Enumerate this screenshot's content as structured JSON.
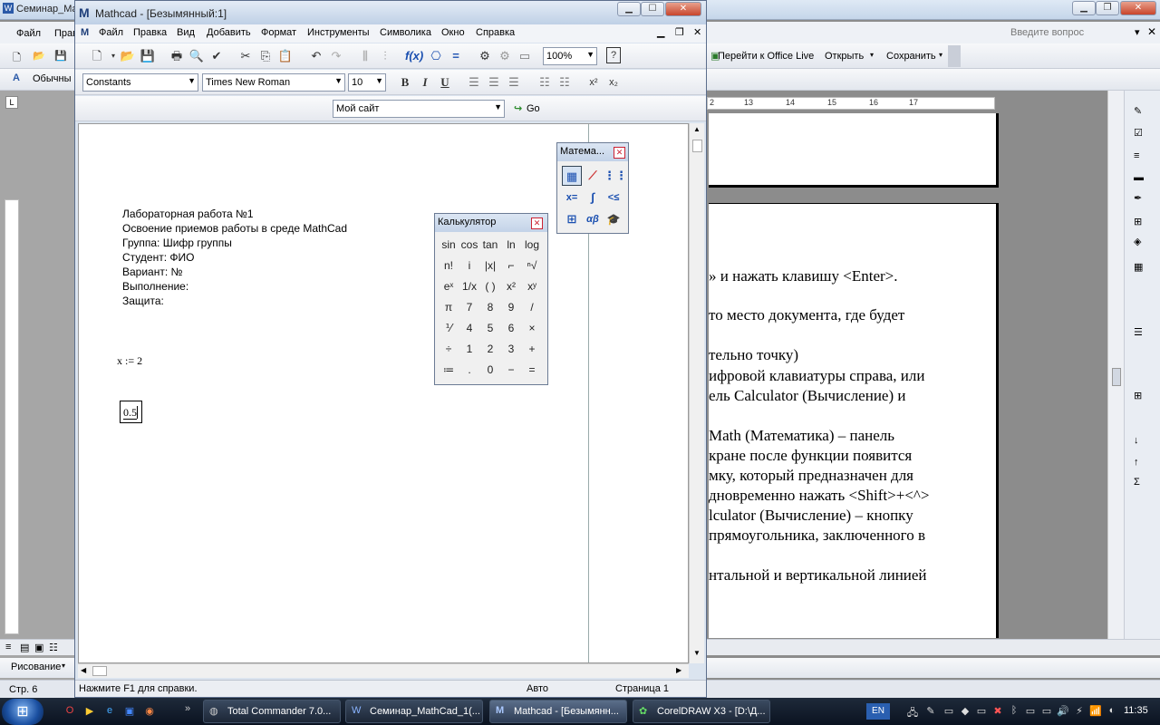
{
  "word": {
    "title": "Семинар_Ма",
    "menu": [
      "Файл",
      "Прав"
    ],
    "style_label": "Обычны",
    "office_live": "Перейти к Office Live",
    "open": "Открыть",
    "save": "Сохранить",
    "question_placeholder": "Введите вопрос",
    "ruler_ticks": [
      "2",
      "13",
      "14",
      "15",
      "16",
      "17"
    ],
    "page_lines": [
      "» и нажать клавишу <Enter>.",
      "то место документа, где будет",
      "тельно точку)",
      "ифровой клавиатуры справа, или",
      "ель Calculator (Вычисление) и",
      "Math (Математика) – панель",
      "кране после функции появится",
      "мку, который предназначен для",
      "дновременно нажать <Shift>+<^>",
      "lculator (Вычисление) – кнопку",
      "прямоугольника, заключенного в",
      "нтальной и вертикальной линией"
    ],
    "draw_label": "Рисование",
    "status_page": "Стр. 6",
    "status_page_num": "6"
  },
  "mathcad": {
    "title": "Mathcad - [Безымянный:1]",
    "menu": [
      "Файл",
      "Правка",
      "Вид",
      "Добавить",
      "Формат",
      "Инструменты",
      "Символика",
      "Окно",
      "Справка"
    ],
    "zoom": "100%",
    "style_combo": "Constants",
    "font_combo": "Times New Roman",
    "size_combo": "10",
    "bold": "B",
    "italic": "I",
    "underline": "U",
    "site_combo": "Мой сайт",
    "go": "Go",
    "doc_lines": [
      "Лабораторная работа №1",
      "Освоение приемов работы в среде MathCad",
      "Группа: Шифр группы",
      "Студент: ФИО",
      "Вариант: №",
      "Выполнение:",
      "Защита:"
    ],
    "expr": "x := 2",
    "input_value": "0.5",
    "status_help": "Нажмите F1 для справки.",
    "status_mode": "Авто",
    "status_page": "Страница 1"
  },
  "math_palette": {
    "title": "Матема...",
    "icons": [
      "calculator-icon",
      "graph-icon",
      "matrix-icon",
      "evaluation-icon",
      "calculus-icon",
      "boolean-icon",
      "programming-icon",
      "greek-icon",
      "symbolic-icon"
    ],
    "glyphs": [
      "▦",
      "⟋",
      "⋮⋮",
      "x=",
      "∫",
      "<≤",
      "⊞",
      "αβ",
      "🎓"
    ]
  },
  "calculator": {
    "title": "Калькулятор",
    "keys": [
      [
        "sin",
        "cos",
        "tan",
        "ln",
        "log"
      ],
      [
        "n!",
        "i",
        "|x|",
        "⌐",
        "ⁿ√"
      ],
      [
        "eˣ",
        "1/x",
        "( )",
        "x²",
        "xʸ"
      ],
      [
        "π",
        "7",
        "8",
        "9",
        "/"
      ],
      [
        "⅟",
        "4",
        "5",
        "6",
        "×"
      ],
      [
        "÷",
        "1",
        "2",
        "3",
        "+"
      ],
      [
        "≔",
        ".",
        "0",
        "−",
        "="
      ]
    ]
  },
  "taskbar": {
    "tasks": [
      "Total Commander 7.0...",
      "Семинар_MathCad_1(...",
      "Mathcad - [Безымянн...",
      "CorelDRAW X3 - [D:\\Д..."
    ],
    "lang": "EN",
    "clock": "11:35"
  }
}
